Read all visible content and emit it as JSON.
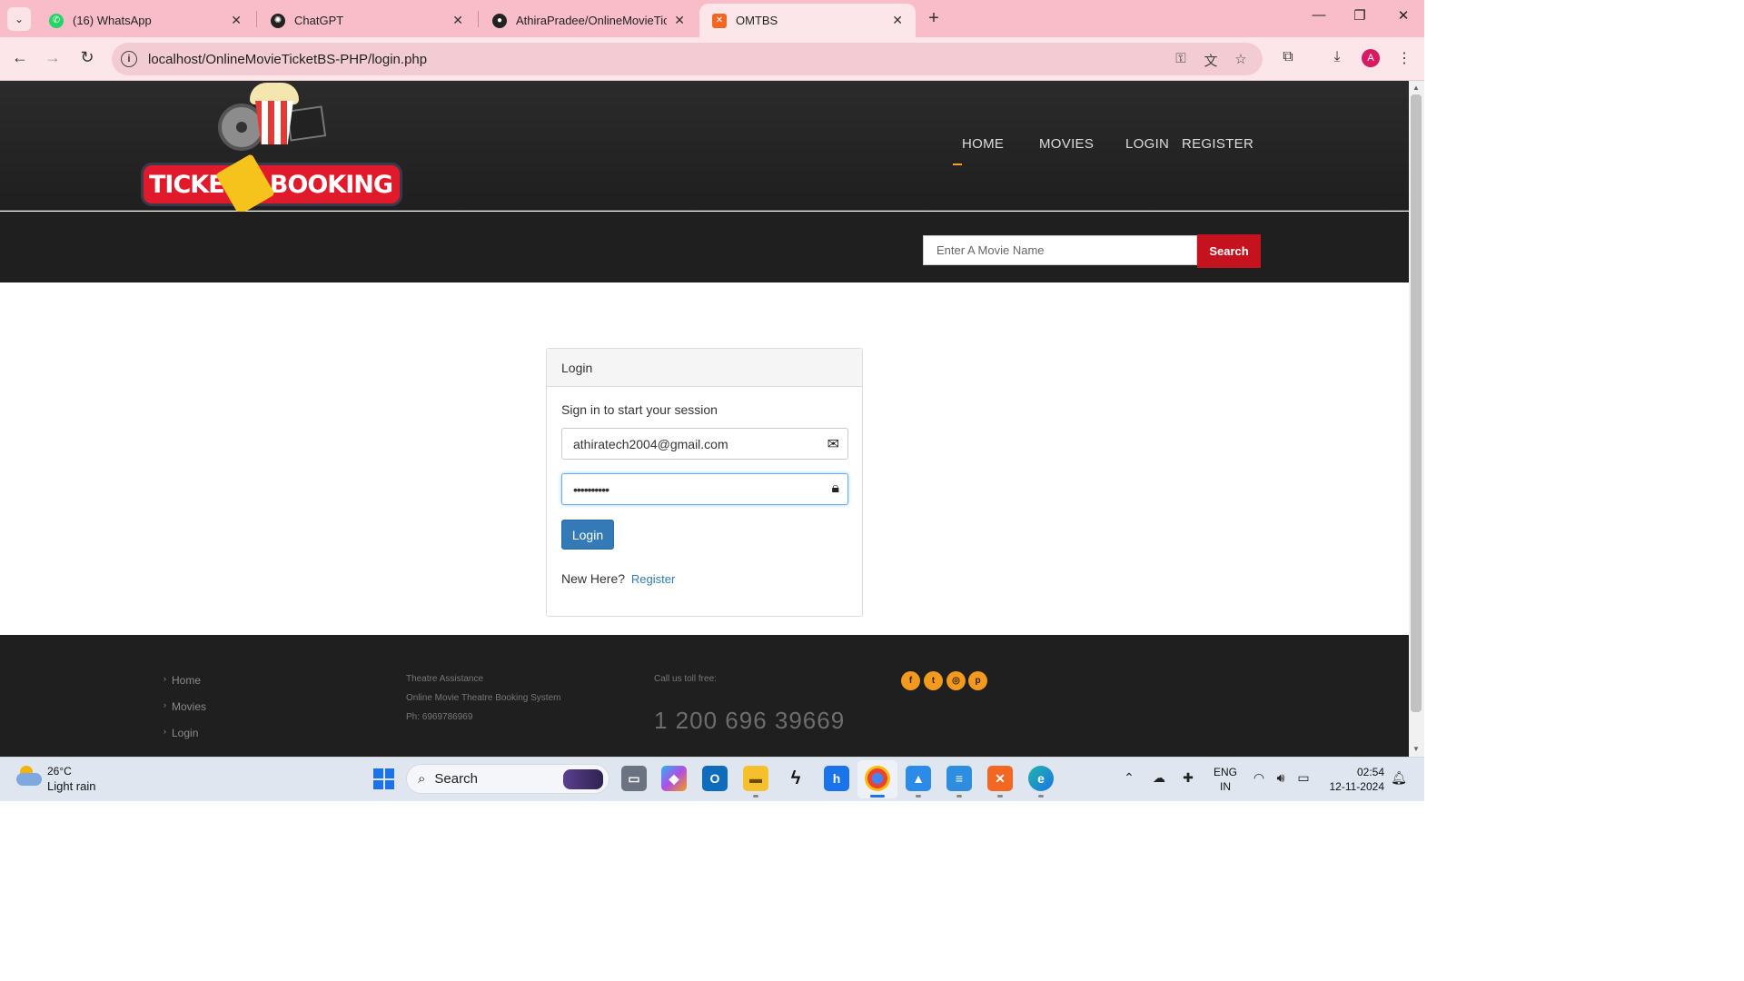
{
  "browser": {
    "tabs": [
      {
        "title": "(16) WhatsApp",
        "favicon": "whatsapp-icon",
        "color": "#25d366"
      },
      {
        "title": "ChatGPT",
        "favicon": "chatgpt-icon",
        "color": "#222222"
      },
      {
        "title": "AthiraPradee/OnlineMovieTicke",
        "favicon": "github-icon",
        "color": "#222222"
      },
      {
        "title": "OMTBS",
        "favicon": "xampp-icon",
        "color": "#f26722",
        "active": true
      }
    ],
    "url": "localhost/OnlineMovieTicketBS-PHP/login.php",
    "profile_initial": "A"
  },
  "site": {
    "logo_text_left": "TICKE",
    "logo_text_right": "BOOKING",
    "nav": [
      "HOME",
      "MOVIES",
      "LOGIN",
      "REGISTER"
    ],
    "search": {
      "placeholder": "Enter A Movie Name",
      "button": "Search"
    }
  },
  "login": {
    "header": "Login",
    "subtitle": "Sign in to start your session",
    "email_value": "athiratech2004@gmail.com",
    "password_value": "••••••••••",
    "button": "Login",
    "new_here": "New Here?",
    "register_link": "Register"
  },
  "footer": {
    "links": [
      "Home",
      "Movies",
      "Login"
    ],
    "assist_title": "Theatre Assistance",
    "assist_name": "Online Movie Theatre Booking System",
    "assist_phone": "Ph: 6969786969",
    "tollfree_label": "Call us toll free:",
    "tollfree_number": "1 200 696 39669",
    "social": [
      "facebook-icon",
      "twitter-icon",
      "dribbble-icon",
      "pinterest-icon"
    ],
    "accent_color": "#f29a1f"
  },
  "taskbar": {
    "temperature": "26°C",
    "weather": "Light rain",
    "search_label": "Search",
    "lang_top": "ENG",
    "lang_bottom": "IN",
    "time": "02:54",
    "date": "12-11-2024"
  }
}
